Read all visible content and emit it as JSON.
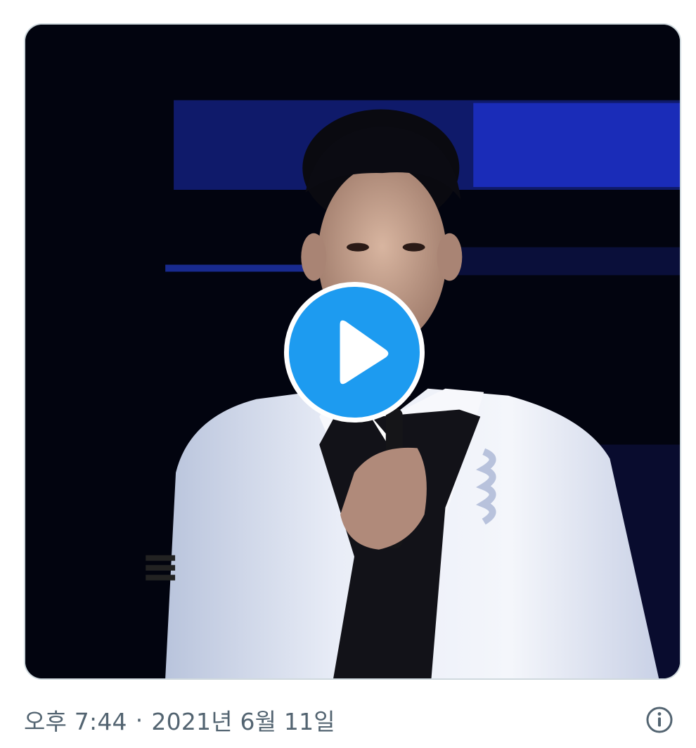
{
  "tweet": {
    "media": {
      "type": "video",
      "thumbnail": "person-with-microphone-on-stage"
    },
    "time": "오후 7:44",
    "separator": "·",
    "date": "2021년 6월 11일"
  },
  "icons": {
    "play": "play-icon",
    "info": "info-icon"
  },
  "colors": {
    "accent": "#1d9bf0",
    "meta_text": "#536471",
    "border": "#cfd9de",
    "video_bg": "#02040f"
  }
}
